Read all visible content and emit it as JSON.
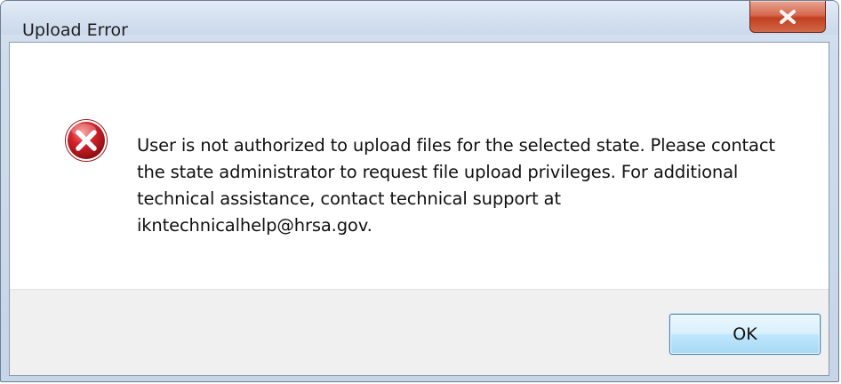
{
  "window": {
    "title": "Upload Error",
    "close_icon": "close-x-icon"
  },
  "dialog": {
    "icon": "error-icon",
    "message": "User is not authorized to upload files for the selected state. Please contact the state administrator to request file upload privileges. For additional technical assistance, contact technical support at ikntechnicalhelp@hrsa.gov.",
    "ok_label": "OK"
  },
  "colors": {
    "close_button": "#c7462a",
    "error_icon": "#c8202a",
    "ok_button_border": "#3c7fb1"
  }
}
